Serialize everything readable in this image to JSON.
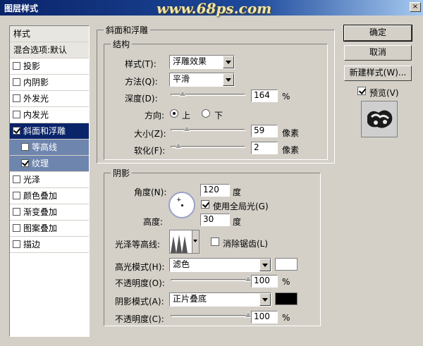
{
  "window": {
    "title": "图层样式",
    "watermark": "www.68ps.com",
    "close_glyph": "×"
  },
  "styles_list": {
    "header": "样式",
    "blending": "混合选项:默认",
    "items": [
      {
        "label": "投影",
        "checked": false
      },
      {
        "label": "内阴影",
        "checked": false
      },
      {
        "label": "外发光",
        "checked": false
      },
      {
        "label": "内发光",
        "checked": false
      },
      {
        "label": "斜面和浮雕",
        "checked": true
      },
      {
        "label": "等高线",
        "checked": false
      },
      {
        "label": "纹理",
        "checked": true
      },
      {
        "label": "光泽",
        "checked": false
      },
      {
        "label": "颜色叠加",
        "checked": false
      },
      {
        "label": "渐变叠加",
        "checked": false
      },
      {
        "label": "图案叠加",
        "checked": false
      },
      {
        "label": "描边",
        "checked": false
      }
    ]
  },
  "bevel": {
    "group_title": "斜面和浮雕",
    "structure_title": "结构",
    "style_label": "样式(T):",
    "style_value": "浮雕效果",
    "technique_label": "方法(Q):",
    "technique_value": "平滑",
    "depth_label": "深度(D):",
    "depth_value": "164",
    "depth_unit": "%",
    "depth_fraction": 0.16,
    "direction_label": "方向:",
    "direction_up": "上",
    "direction_down": "下",
    "size_label": "大小(Z):",
    "size_value": "59",
    "size_unit": "像素",
    "size_fraction": 0.22,
    "soften_label": "软化(F):",
    "soften_value": "2",
    "soften_unit": "像素",
    "soften_fraction": 0.1
  },
  "shading": {
    "title": "阴影",
    "angle_label": "角度(N):",
    "angle_value": "120",
    "angle_unit": "度",
    "global_light_label": "使用全局光(G)",
    "altitude_label": "高度:",
    "altitude_value": "30",
    "altitude_unit": "度",
    "gloss_label": "光泽等高线:",
    "antialias_label": "消除锯齿(L)",
    "highlight_mode_label": "高光模式(H):",
    "highlight_mode_value": "滤色",
    "highlight_color": "#ffffff",
    "opacity1_label": "不透明度(O):",
    "opacity1_value": "100",
    "opacity1_unit": "%",
    "shadow_mode_label": "阴影模式(A):",
    "shadow_mode_value": "正片叠底",
    "shadow_color": "#000000",
    "opacity2_label": "不透明度(C):",
    "opacity2_value": "100",
    "opacity2_unit": "%"
  },
  "buttons": {
    "ok": "确定",
    "cancel": "取消",
    "new_style": "新建样式(W)...",
    "preview": "预览(V)"
  }
}
